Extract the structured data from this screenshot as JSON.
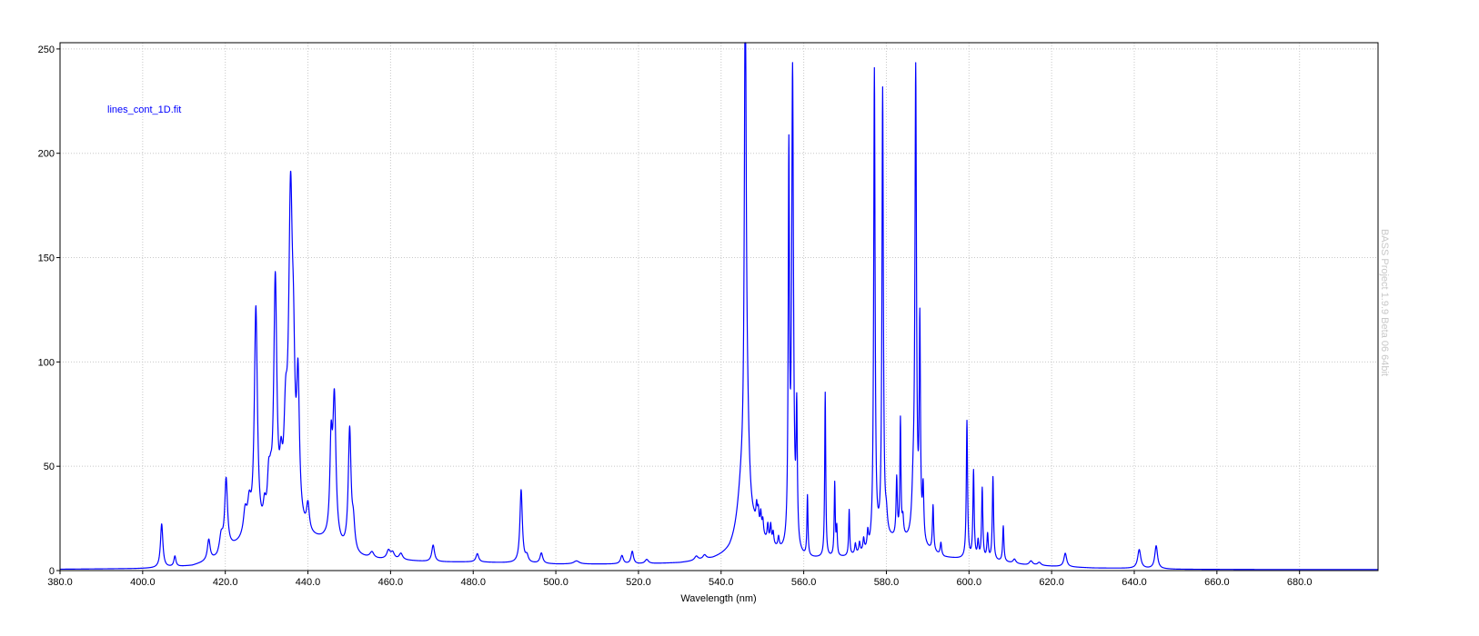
{
  "chart_data": {
    "type": "line",
    "xlabel": "Wavelength (nm)",
    "ylabel": "",
    "xlim": [
      380.0,
      699.0
    ],
    "ylim": [
      0,
      253
    ],
    "xticks": [
      380.0,
      400.0,
      420.0,
      440.0,
      460.0,
      480.0,
      500.0,
      520.0,
      540.0,
      560.0,
      580.0,
      600.0,
      620.0,
      640.0,
      660.0,
      680.0
    ],
    "xtick_labels": [
      "380.0",
      "400.0",
      "420.0",
      "440.0",
      "460.0",
      "480.0",
      "500.0",
      "520.0",
      "540.0",
      "560.0",
      "580.0",
      "600.0",
      "620.0",
      "640.0",
      "660.0",
      "680.0"
    ],
    "yticks": [
      0,
      50,
      100,
      150,
      200,
      250
    ],
    "ytick_labels": [
      "0",
      "50",
      "100",
      "150",
      "200",
      "250"
    ],
    "grid": true,
    "annotation": "lines_cont_1D.fit",
    "watermark": "BASS Project 1.9.9 Beta 06 64bit",
    "series": [
      {
        "color": "#0000ff",
        "baseline": [
          [
            380,
            0.6
          ],
          [
            398,
            0.8
          ],
          [
            404,
            1.0
          ],
          [
            412,
            2.0
          ],
          [
            418,
            5.0
          ],
          [
            420,
            9.0
          ],
          [
            424,
            12.0
          ],
          [
            428,
            12.0
          ],
          [
            432,
            14.0
          ],
          [
            436,
            17.0
          ],
          [
            440,
            14.0
          ],
          [
            444,
            13.0
          ],
          [
            448,
            9.0
          ],
          [
            452,
            6.0
          ],
          [
            456,
            5.0
          ],
          [
            460,
            5.0
          ],
          [
            470,
            4.0
          ],
          [
            480,
            4.0
          ],
          [
            490,
            3.5
          ],
          [
            500,
            3.0
          ],
          [
            510,
            3.0
          ],
          [
            520,
            3.0
          ],
          [
            530,
            3.5
          ],
          [
            538,
            5.0
          ],
          [
            542,
            7.0
          ],
          [
            544,
            10.0
          ],
          [
            548,
            16.0
          ],
          [
            552,
            10.0
          ],
          [
            556,
            6.0
          ],
          [
            560,
            5.0
          ],
          [
            570,
            6.0
          ],
          [
            576,
            8.0
          ],
          [
            578,
            12.0
          ],
          [
            580,
            14.0
          ],
          [
            584,
            14.0
          ],
          [
            586,
            12.0
          ],
          [
            590,
            9.0
          ],
          [
            594,
            6.0
          ],
          [
            600,
            5.0
          ],
          [
            608,
            4.0
          ],
          [
            614,
            2.5
          ],
          [
            620,
            2.0
          ],
          [
            630,
            1.2
          ],
          [
            640,
            1.0
          ],
          [
            650,
            0.6
          ],
          [
            670,
            0.5
          ],
          [
            699,
            0.5
          ]
        ],
        "peaks": [
          [
            404.6,
            21,
            0.35
          ],
          [
            407.8,
            5,
            0.3
          ],
          [
            416.0,
            10,
            0.4
          ],
          [
            419.0,
            8,
            0.5
          ],
          [
            420.2,
            33,
            0.4
          ],
          [
            424.8,
            12,
            0.5
          ],
          [
            425.8,
            14,
            0.5
          ],
          [
            427.4,
            110,
            0.45
          ],
          [
            429.5,
            10,
            0.4
          ],
          [
            430.5,
            20,
            0.4
          ],
          [
            431.0,
            12,
            0.4
          ],
          [
            432.1,
            118,
            0.45
          ],
          [
            433.5,
            20,
            0.4
          ],
          [
            434.6,
            40,
            0.5
          ],
          [
            435.8,
            150,
            0.55
          ],
          [
            436.5,
            50,
            0.4
          ],
          [
            437.6,
            64,
            0.4
          ],
          [
            440.0,
            13,
            0.4
          ],
          [
            445.6,
            42,
            0.35
          ],
          [
            446.4,
            68,
            0.45
          ],
          [
            450.1,
            58,
            0.4
          ],
          [
            451.0,
            12,
            0.4
          ],
          [
            455.5,
            3,
            0.6
          ],
          [
            459.5,
            4,
            0.5
          ],
          [
            460.5,
            3,
            0.5
          ],
          [
            462.5,
            3,
            0.5
          ],
          [
            470.3,
            8,
            0.4
          ],
          [
            481.0,
            4,
            0.4
          ],
          [
            491.6,
            35,
            0.35
          ],
          [
            493.0,
            3,
            0.4
          ],
          [
            496.5,
            5,
            0.4
          ],
          [
            505.0,
            1.5,
            0.8
          ],
          [
            516.0,
            4,
            0.4
          ],
          [
            518.5,
            6,
            0.35
          ],
          [
            522.0,
            2,
            0.5
          ],
          [
            534.0,
            2,
            0.5
          ],
          [
            536.0,
            2,
            0.5
          ],
          [
            545.85,
            240,
            0.25
          ],
          [
            545.0,
            25,
            1.3
          ],
          [
            546.3,
            40,
            0.6
          ],
          [
            548.6,
            9,
            0.2
          ],
          [
            549.0,
            8,
            0.2
          ],
          [
            549.6,
            9,
            0.2
          ],
          [
            550.1,
            7,
            0.2
          ],
          [
            551.3,
            8,
            0.2
          ],
          [
            552.0,
            9,
            0.2
          ],
          [
            552.6,
            6,
            0.2
          ],
          [
            553.9,
            5,
            0.2
          ],
          [
            556.4,
            184,
            0.18
          ],
          [
            557.3,
            228,
            0.26
          ],
          [
            558.3,
            63,
            0.18
          ],
          [
            560.9,
            29,
            0.15
          ],
          [
            565.2,
            79,
            0.15
          ],
          [
            567.5,
            35,
            0.15
          ],
          [
            568.0,
            13,
            0.15
          ],
          [
            571.0,
            22,
            0.15
          ],
          [
            572.5,
            5,
            0.2
          ],
          [
            573.5,
            5,
            0.2
          ],
          [
            574.5,
            6,
            0.2
          ],
          [
            575.5,
            8,
            0.2
          ],
          [
            577.1,
            228,
            0.2
          ],
          [
            579.1,
            215,
            0.2
          ],
          [
            580.0,
            8,
            0.3
          ],
          [
            582.5,
            28,
            0.18
          ],
          [
            583.4,
            56,
            0.15
          ],
          [
            584.0,
            8,
            0.2
          ],
          [
            586.5,
            20,
            0.4
          ],
          [
            587.1,
            222,
            0.22
          ],
          [
            588.1,
            102,
            0.18
          ],
          [
            588.9,
            25,
            0.2
          ],
          [
            591.3,
            22,
            0.18
          ],
          [
            593.2,
            6,
            0.2
          ],
          [
            599.5,
            66,
            0.18
          ],
          [
            601.1,
            42,
            0.18
          ],
          [
            602.2,
            8,
            0.2
          ],
          [
            603.2,
            34,
            0.18
          ],
          [
            604.5,
            12,
            0.2
          ],
          [
            605.8,
            40,
            0.18
          ],
          [
            608.3,
            17,
            0.18
          ],
          [
            611.0,
            2,
            0.4
          ],
          [
            615.0,
            2,
            0.5
          ],
          [
            617.0,
            1.5,
            0.5
          ],
          [
            623.3,
            6.5,
            0.4
          ],
          [
            641.2,
            9,
            0.45
          ],
          [
            645.3,
            11,
            0.4
          ]
        ]
      }
    ]
  }
}
